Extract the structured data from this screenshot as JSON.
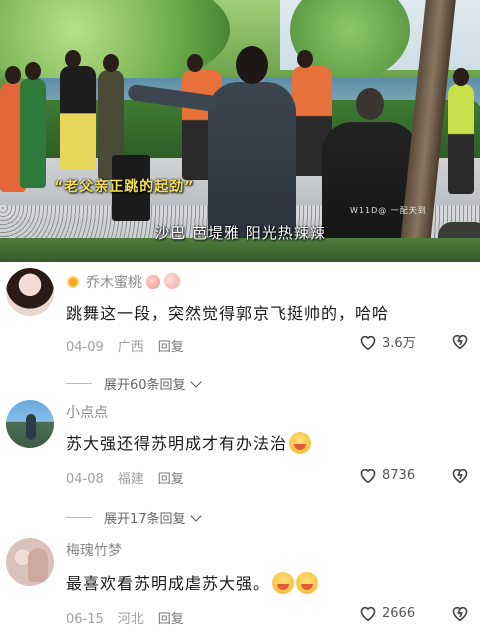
{
  "video": {
    "caption": "“老父亲正跳的起劲”",
    "subtitle": "沙巴 芭堤雅 阳光热辣辣",
    "watermark": "W11D@ 一配天到"
  },
  "comments": [
    {
      "username": "乔木蜜桃",
      "text": "跳舞这一段，突然觉得郭京飞挺帅的，哈哈",
      "date": "04-09",
      "location": "广西",
      "reply_label": "回复",
      "likes": "3.6万",
      "expand_label": "展开60条回复"
    },
    {
      "username": "小点点",
      "text": "苏大强还得苏明成才有办法治",
      "date": "04-08",
      "location": "福建",
      "reply_label": "回复",
      "likes": "8736",
      "expand_label": "展开17条回复"
    },
    {
      "username": "梅瑰竹梦",
      "text": "最喜欢看苏明成虐苏大强。",
      "date": "06-15",
      "location": "河北",
      "reply_label": "回复",
      "likes": "2666"
    }
  ],
  "colors": {
    "caption": "#f5e05a",
    "meta": "#a0a0a0",
    "username": "#8a8a8a"
  }
}
